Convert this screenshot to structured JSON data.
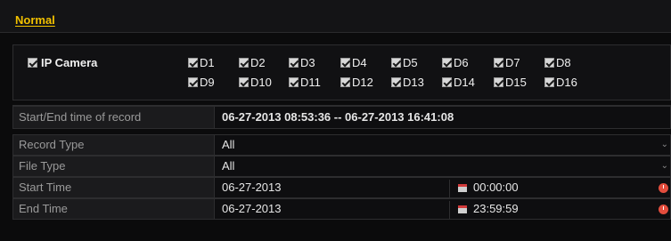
{
  "tabs": [
    {
      "label": "Normal"
    }
  ],
  "camera": {
    "label": "IP Camera",
    "channels": [
      "D1",
      "D2",
      "D3",
      "D4",
      "D5",
      "D6",
      "D7",
      "D8",
      "D9",
      "D10",
      "D11",
      "D12",
      "D13",
      "D14",
      "D15",
      "D16"
    ]
  },
  "record_info": {
    "label": "Start/End time of record",
    "value": "06-27-2013 08:53:36 -- 06-27-2013 16:41:08"
  },
  "record_type": {
    "label": "Record Type",
    "value": "All"
  },
  "file_type": {
    "label": "File Type",
    "value": "All"
  },
  "start_time": {
    "label": "Start Time",
    "date": "06-27-2013",
    "time": "00:00:00"
  },
  "end_time": {
    "label": "End Time",
    "date": "06-27-2013",
    "time": "23:59:59"
  },
  "colors": {
    "accent": "#f2c100",
    "background": "#0b0b0c",
    "calendar_icon": "#d23b3b",
    "clock_icon": "#e34d3d"
  },
  "icons": [
    "checkbox-checked-icon",
    "chevron-down-icon",
    "calendar-icon",
    "clock-icon"
  ]
}
